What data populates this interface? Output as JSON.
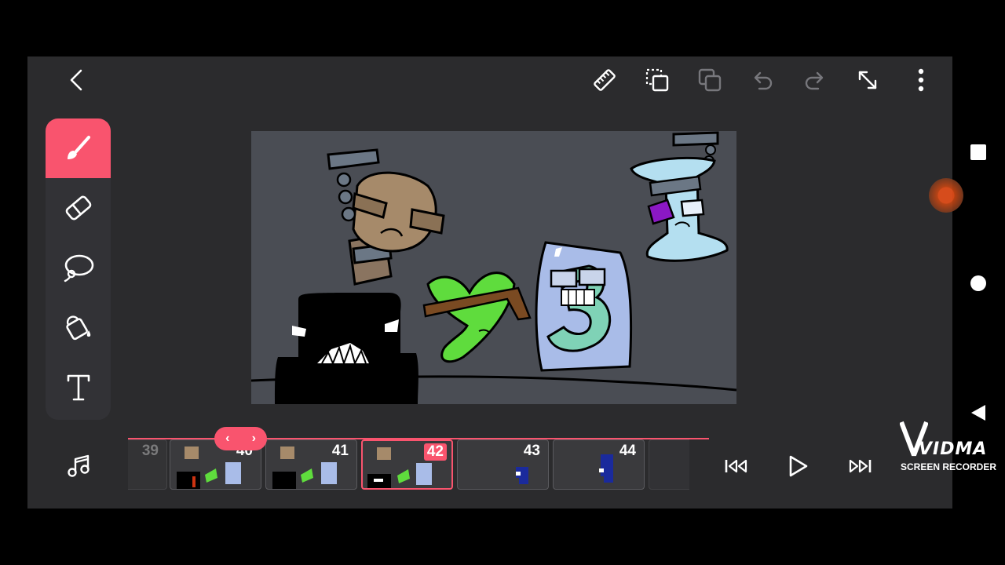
{
  "toolbar": {
    "back": "back-arrow-icon",
    "items": [
      "ruler-icon",
      "copy-select-icon",
      "duplicate-icon",
      "undo-icon",
      "redo-icon",
      "fullscreen-icon",
      "more-icon"
    ]
  },
  "tools": [
    "brush-icon",
    "eraser-icon",
    "lasso-icon",
    "fill-bucket-icon",
    "text-icon"
  ],
  "active_tool": "brush",
  "accent_color": "#f9546e",
  "timeline": {
    "frames": [
      {
        "num": "39"
      },
      {
        "num": "40"
      },
      {
        "num": "41"
      },
      {
        "num": "42"
      },
      {
        "num": "43"
      },
      {
        "num": "44"
      }
    ],
    "current_frame": "42",
    "nav_left": "‹",
    "nav_right": "›"
  },
  "playback": [
    "skip-back-icon",
    "play-icon",
    "skip-forward-icon"
  ],
  "watermark": {
    "title": "VIDMA",
    "subtitle": "SCREEN RECORDER"
  },
  "system_nav": [
    "recent-apps-icon",
    "home-icon",
    "back-icon"
  ]
}
